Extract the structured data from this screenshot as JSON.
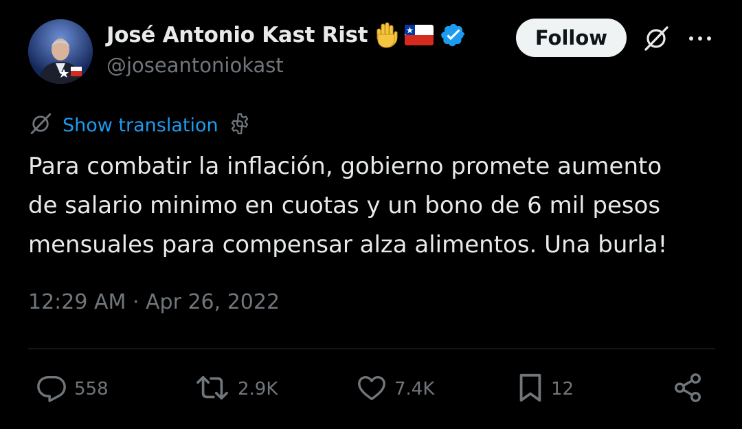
{
  "author": {
    "display_name": "José Antonio Kast Rist",
    "handle": "@joseantoniokast",
    "emoji": [
      "raised-hand",
      "flag-chile"
    ],
    "verified": true,
    "verified_color": "#1d9bf0"
  },
  "header": {
    "follow_label": "Follow",
    "icons": [
      "grok-icon",
      "more-icon"
    ]
  },
  "translation": {
    "label": "Show translation",
    "link_color": "#1d9bf0"
  },
  "tweet": {
    "lines": [
      "Para combatir la inflación, gobierno promete aumento",
      "de salario minimo en cuotas y un bono de 6 mil pesos",
      "mensuales para compensar alza alimentos. Una burla!"
    ],
    "time": "12:29 AM",
    "separator": " · ",
    "date": "Apr 26, 2022"
  },
  "actions": {
    "replies": "558",
    "retweets": "2.9K",
    "likes": "7.4K",
    "bookmarks": "12"
  },
  "colors": {
    "background": "#000000",
    "text": "#e7e9ea",
    "muted": "#71767b",
    "divider": "#2f3336"
  }
}
